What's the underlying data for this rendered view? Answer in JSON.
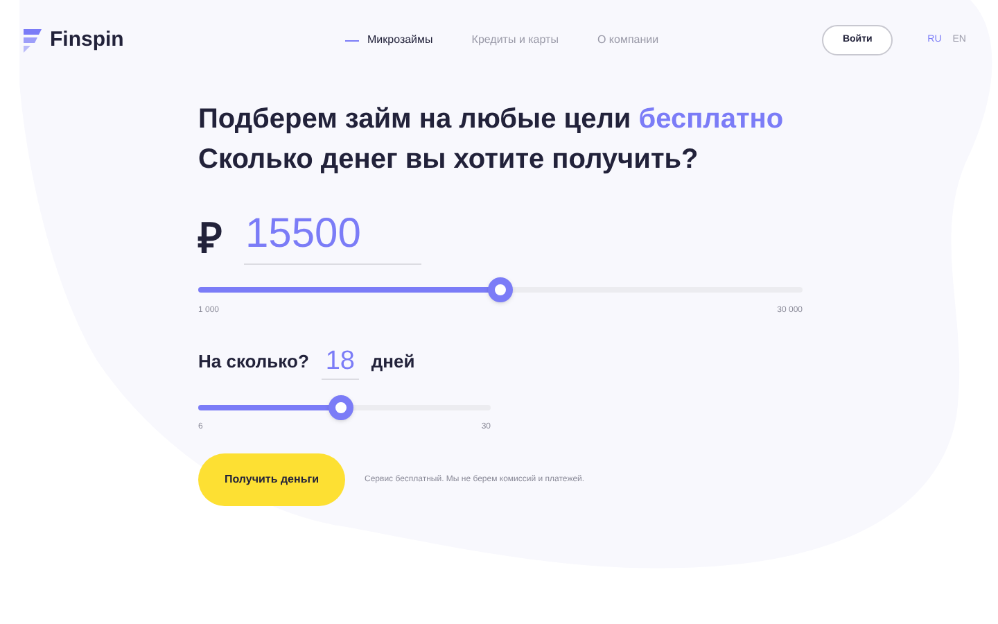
{
  "logo": {
    "text": "Finspin"
  },
  "nav": [
    {
      "label": "Микрозаймы",
      "selected": true
    },
    {
      "label": "Кредиты и карты",
      "selected": false
    },
    {
      "label": "О компании",
      "selected": false
    }
  ],
  "login_button": "Войти",
  "languages": [
    {
      "label": "RU",
      "selected": true
    },
    {
      "label": "EN",
      "selected": false
    }
  ],
  "heading": {
    "line1": "Подберем займ на любые цели",
    "line1_highlight": "бесплатно",
    "line2": "Сколько денег вы хотите получить?"
  },
  "amount": {
    "currency": "₽",
    "value": "15500",
    "level": 0.5,
    "min": "1 000",
    "max": "30 000"
  },
  "term": {
    "label": "На сколько?",
    "value": "18",
    "unit": "дней",
    "level": 0.49,
    "min": "6",
    "max": "30"
  },
  "submit_button": "Получить деньги",
  "note": "Сервис бесплатный. Мы не берем комиссий и платежей."
}
